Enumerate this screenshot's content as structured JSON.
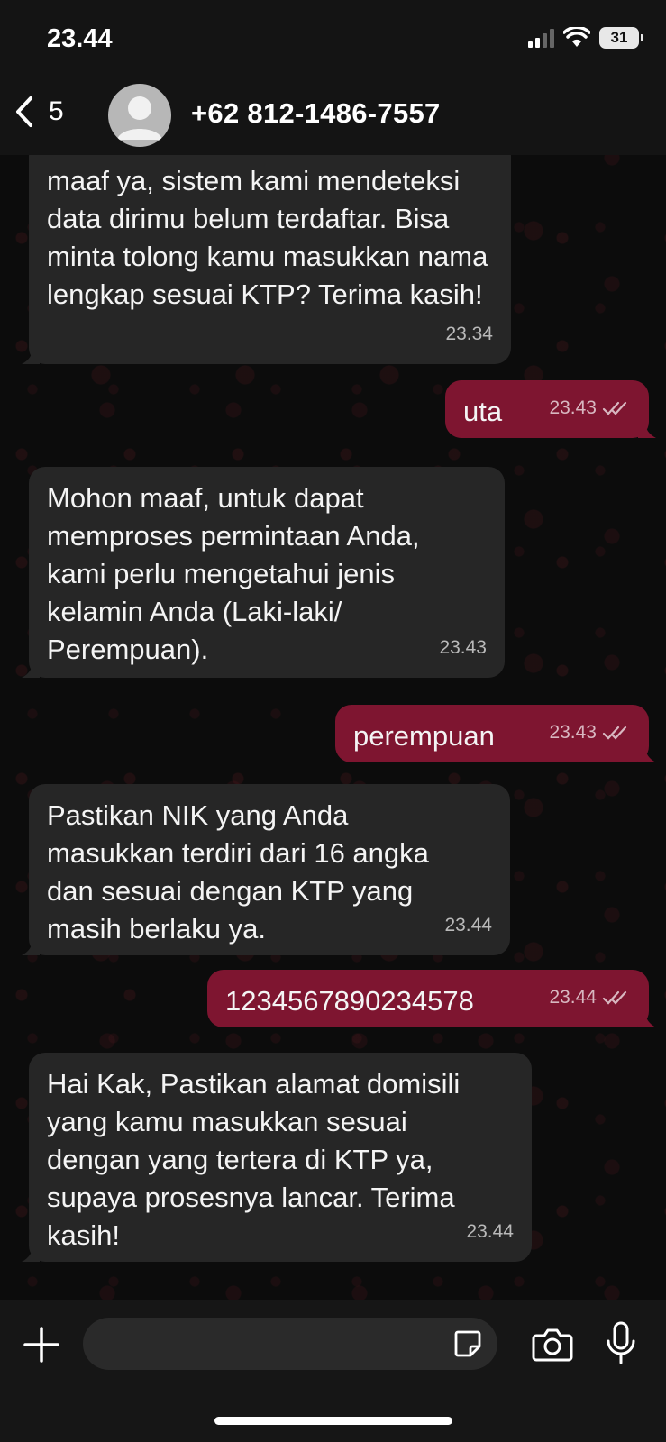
{
  "status_bar": {
    "time": "23.44",
    "battery": "31"
  },
  "header": {
    "back_count": "5",
    "contact": "+62 812-1486-7557"
  },
  "messages": [
    {
      "direction": "in",
      "text": "maaf ya, sistem kami mendeteksi data dirimu belum terdaftar.  Bisa minta tolong kamu masukkan nama lengkap sesuai KTP? Terima kasih!",
      "time": "23.34"
    },
    {
      "direction": "out",
      "text": "uta",
      "time": "23.43"
    },
    {
      "direction": "in",
      "text": "Mohon maaf, untuk dapat memproses permintaan Anda, kami perlu mengetahui jenis kelamin Anda (Laki-laki/ Perempuan).",
      "time": "23.43"
    },
    {
      "direction": "out",
      "text": "perempuan",
      "time": "23.43"
    },
    {
      "direction": "in",
      "text": "Pastikan NIK yang Anda masukkan terdiri dari 16 angka dan sesuai dengan KTP yang masih berlaku ya.",
      "time": "23.44"
    },
    {
      "direction": "out",
      "text": "1234567890234578",
      "time": "23.44"
    },
    {
      "direction": "in",
      "text": "Hai Kak,  Pastikan alamat domisili yang kamu masukkan sesuai dengan yang tertera di KTP ya, supaya prosesnya lancar.  Terima kasih!",
      "time": "23.44"
    }
  ],
  "composer": {
    "placeholder": ""
  },
  "icons": {
    "back": "chevron-left-icon",
    "avatar": "person-icon",
    "add": "plus-icon",
    "sticker": "sticker-icon",
    "camera": "camera-icon",
    "mic": "microphone-icon",
    "read": "double-check-icon"
  },
  "colors": {
    "incoming_bubble": "#262626",
    "outgoing_bubble": "#7e1530",
    "background": "#0c0c0c"
  }
}
